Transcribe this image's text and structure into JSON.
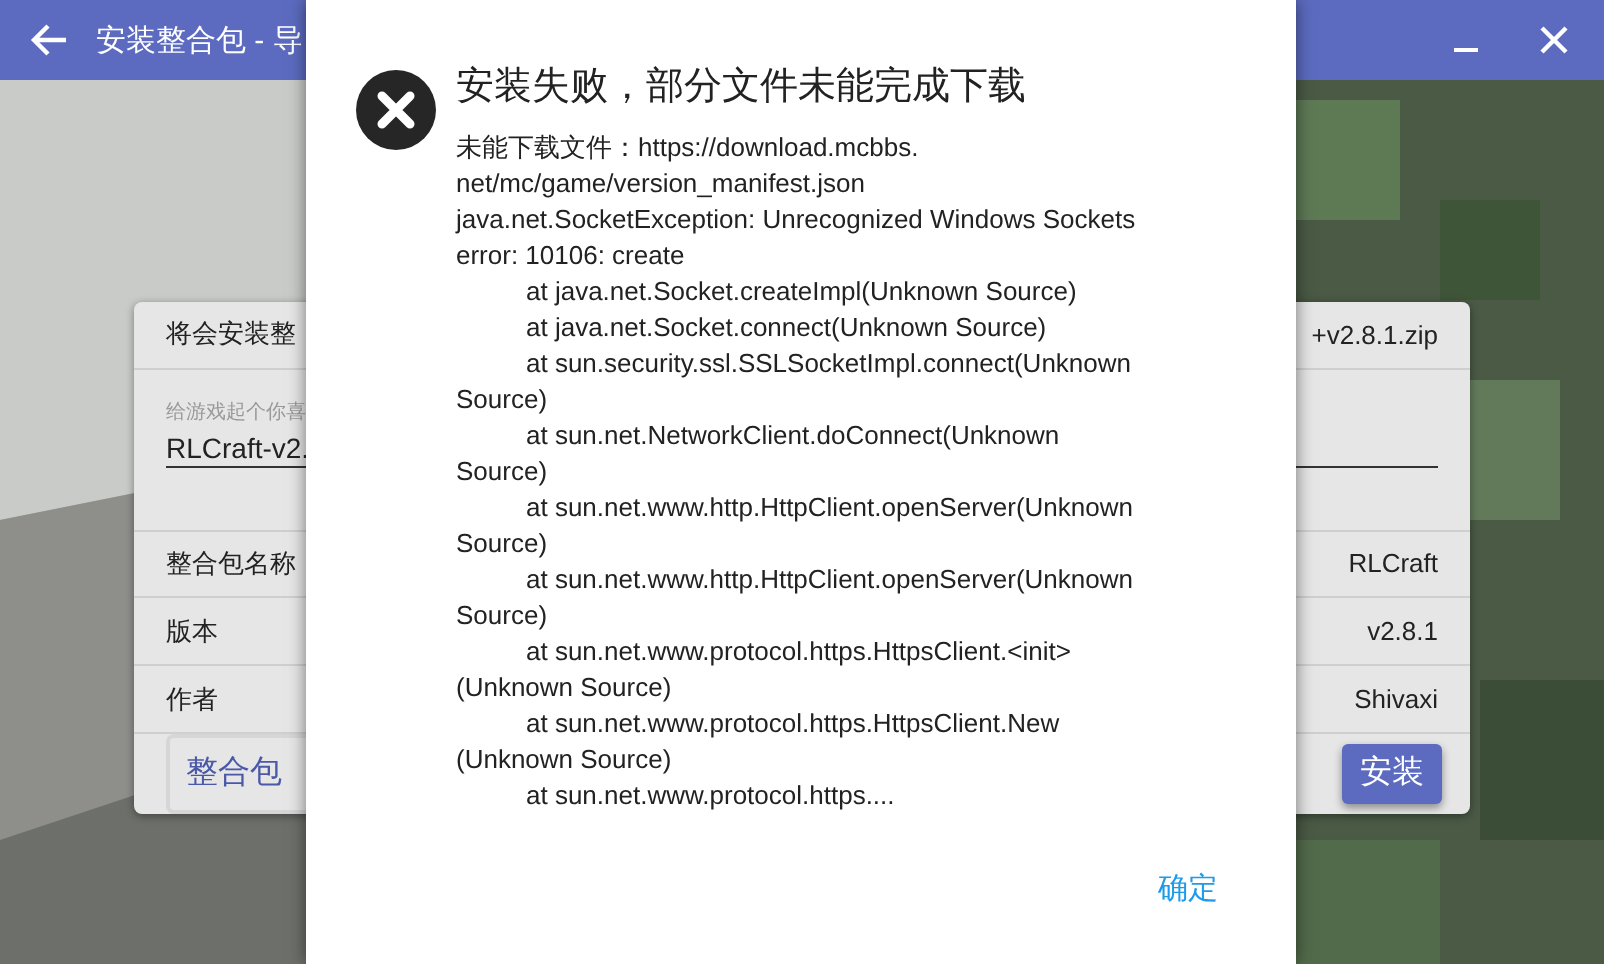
{
  "window": {
    "title": "安装整合包 - 导",
    "buttons": [
      {
        "kind": "minimize"
      },
      {
        "kind": "close"
      }
    ]
  },
  "card": {
    "header": {
      "label": "将会安装整",
      "file": "+v2.8.1.zip"
    },
    "name_field": {
      "placeholder": "给游戏起个你喜",
      "value": "RLCraft-v2."
    },
    "rows": [
      {
        "label": "整合包名称",
        "value": "RLCraft"
      },
      {
        "label": "版本",
        "value": "v2.8.1"
      },
      {
        "label": "作者",
        "value": "Shivaxi"
      }
    ],
    "description_button": "整合包",
    "install_button": "安装"
  },
  "dialog": {
    "title": "安装失败，部分文件未能完成下载",
    "lines": [
      "未能下载文件：https://download.mcbbs.",
      "net/mc/game/version_manifest.json",
      "java.net.SocketException: Unrecognized Windows Sockets",
      "error: 10106: create",
      "\tat java.net.Socket.createImpl(Unknown Source)",
      "\tat java.net.Socket.connect(Unknown Source)",
      "\tat sun.security.ssl.SSLSocketImpl.connect(Unknown",
      "Source)",
      "\tat sun.net.NetworkClient.doConnect(Unknown",
      "Source)",
      "\tat sun.net.www.http.HttpClient.openServer(Unknown",
      "Source)",
      "\tat sun.net.www.http.HttpClient.openServer(Unknown",
      "Source)",
      "\tat sun.net.www.protocol.https.HttpsClient.<init>",
      "(Unknown Source)",
      "\tat sun.net.www.protocol.https.HttpsClient.New",
      "(Unknown Source)",
      "\tat sun.net.www.protocol.https...."
    ],
    "ok_button": "确定"
  }
}
